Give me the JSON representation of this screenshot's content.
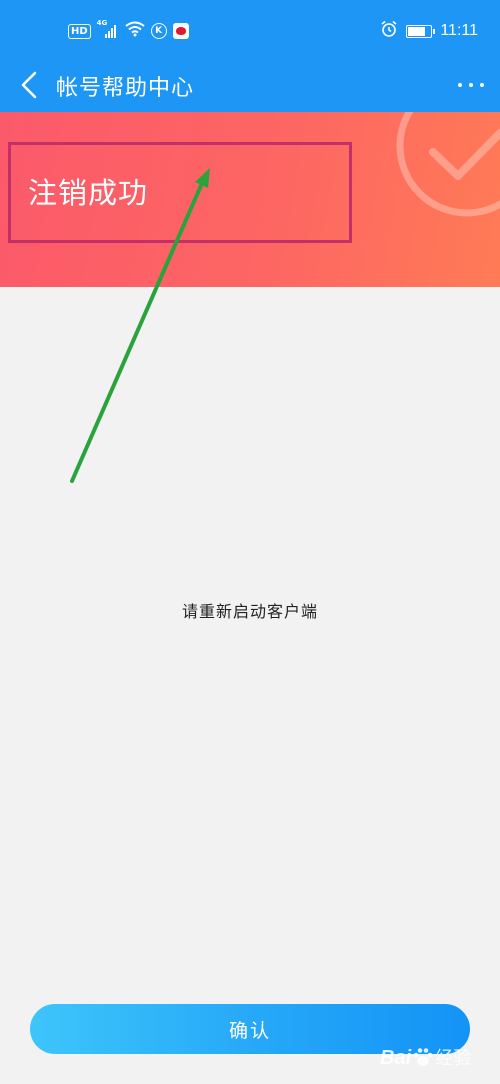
{
  "status_bar": {
    "left_icons": [
      "hd-icon",
      "4g-signal-icon",
      "wifi-icon",
      "k-app-icon",
      "weibo-icon"
    ],
    "hd_label": "HD",
    "net_label": "4G",
    "k_label": "K",
    "time": "11:11",
    "right_icons": [
      "alarm-icon",
      "battery-icon"
    ]
  },
  "header": {
    "back_icon": "chevron-left-icon",
    "title": "帐号帮助中心",
    "more_icon": "more-dots-icon"
  },
  "banner": {
    "title": "注销成功",
    "decor_icon": "check-circle-icon",
    "gradient": [
      "#fb5a6a",
      "#ff7b55"
    ],
    "highlight_color": "#c2306a"
  },
  "annotation": {
    "arrow_color": "#2aa33d"
  },
  "main": {
    "message": "请重新启动客户端"
  },
  "footer": {
    "confirm_label": "确认"
  },
  "watermark": {
    "prefix": "Bai",
    "suffix": "经验",
    "icon": "baidu-paw-icon"
  },
  "colors": {
    "accent": "#1e96f5",
    "background": "#f2f2f2"
  }
}
